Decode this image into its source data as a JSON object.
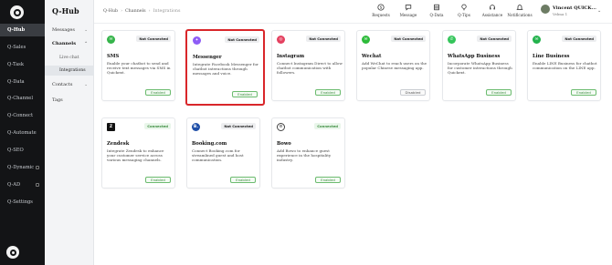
{
  "app": {
    "title": "Q-Hub"
  },
  "rail": {
    "items": [
      {
        "label": "Q-Hub",
        "active": true
      },
      {
        "label": "Q-Sales"
      },
      {
        "label": "Q-Task"
      },
      {
        "label": "Q-Data"
      },
      {
        "label": "Q-Channel"
      },
      {
        "label": "Q-Connect"
      },
      {
        "label": "Q-Automate"
      },
      {
        "label": "Q-SEO"
      },
      {
        "label": "Q-Dynamic"
      },
      {
        "label": "Q-AD"
      },
      {
        "label": "Q-Settings"
      }
    ]
  },
  "submenu": {
    "messages": "Messages",
    "channels": "Channels",
    "live_chat": "Live chat",
    "integrations": "Integrations",
    "contacts": "Contacts",
    "tags": "Tags"
  },
  "breadcrumb": {
    "a": "Q-Hub",
    "b": "Channels",
    "c": "Integrations"
  },
  "header": {
    "icons": [
      {
        "label": "Requests",
        "icon": "dollar-icon"
      },
      {
        "label": "Message",
        "icon": "chat-icon"
      },
      {
        "label": "Q-Data",
        "icon": "database-icon"
      },
      {
        "label": "Q-Tips",
        "icon": "bulb-icon"
      },
      {
        "label": "Assistance",
        "icon": "headset-icon"
      },
      {
        "label": "Notifications",
        "icon": "bell-icon"
      }
    ],
    "user": {
      "name": "Vincent QUICK...",
      "sub": "Velma 1"
    }
  },
  "cards": [
    {
      "name": "SMS",
      "status": "Not Connected",
      "desc": "Enable your chatbot to send and receive text messages via SMS in Quickext.",
      "button": "Enabled",
      "color": "#35b44a",
      "glyph": "✉"
    },
    {
      "name": "Messenger",
      "status": "Not Connected",
      "desc": "Integrate Facebook Messenger for chatbot interactions through messages and voice.",
      "button": "Enabled",
      "color": "#8e5cf6",
      "glyph": "✦"
    },
    {
      "name": "Instagram",
      "status": "Not Connected",
      "desc": "Connect Instagram Direct to allow chatbot communication with followers.",
      "button": "Enabled",
      "color": "#e4405f",
      "glyph": "◎"
    },
    {
      "name": "Wechat",
      "status": "Not Connected",
      "desc": "Add WeChat to reach users on the popular Chinese messaging app.",
      "button": "Disabled",
      "color": "#2dbb3a",
      "glyph": "✉"
    },
    {
      "name": "WhatsApp Business",
      "status": "Not Connected",
      "desc": "Incorporate WhatsApp Business for customer interactions through Quickext.",
      "button": "Enabled",
      "color": "#34c55a",
      "glyph": "✆"
    },
    {
      "name": "Line Business",
      "status": "Not Connected",
      "desc": "Enable LINE Business for chatbot communication on the LINE app.",
      "button": "Enabled",
      "color": "#22b24c",
      "glyph": "✉"
    },
    {
      "name": "Zendesk",
      "status": "Connected",
      "desc": "Integrate Zendesk to enhance your customer service across various messaging channels.",
      "button": "Enabled",
      "color": "#111111",
      "glyph": "Z"
    },
    {
      "name": "Booking.com",
      "status": "Not Connected",
      "desc": "Connect Booking.com for streamlined guest and host communication.",
      "button": "Enabled",
      "color": "#1f4fa8",
      "glyph": "B."
    },
    {
      "name": "Bowo",
      "status": "Connected",
      "desc": "Add Bowo to enhance guest experience in the hospitality industry.",
      "button": "Enabled",
      "color": "#444444",
      "glyph": "⚙"
    }
  ]
}
